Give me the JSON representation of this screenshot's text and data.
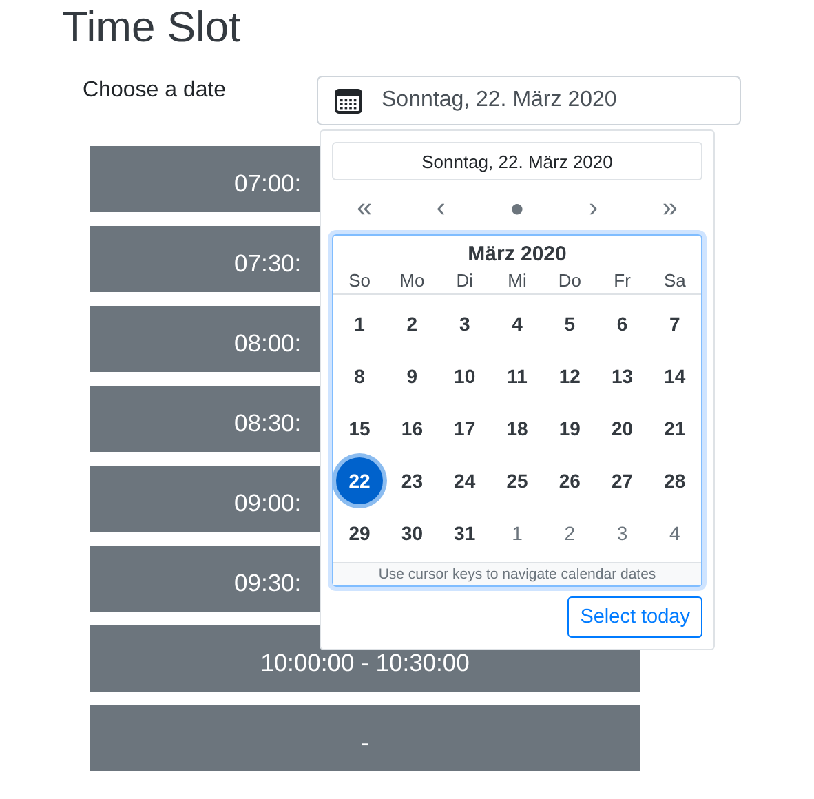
{
  "title": "Time Slot",
  "date_label": "Choose a date",
  "date_field": {
    "value": "Sonntag, 22. März 2020"
  },
  "slots": [
    {
      "label": "07:00:",
      "partly_hidden": true
    },
    {
      "label": "07:30:",
      "partly_hidden": true
    },
    {
      "label": "08:00:",
      "partly_hidden": true
    },
    {
      "label": "08:30:",
      "partly_hidden": true
    },
    {
      "label": "09:00:",
      "partly_hidden": true
    },
    {
      "label": "09:30:",
      "partly_hidden": true
    },
    {
      "label": "10:00:00 - 10:30:00",
      "partly_hidden": false
    },
    {
      "label": "-",
      "partly_hidden": false
    }
  ],
  "datepicker": {
    "selected_value": "Sonntag, 22. März 2020",
    "nav": [
      "«",
      "‹",
      "●",
      "›",
      "»"
    ],
    "month": "März 2020",
    "weekdays": [
      "So",
      "Mo",
      "Di",
      "Mi",
      "Do",
      "Fr",
      "Sa"
    ],
    "weeks": [
      [
        {
          "label": "1",
          "selected": false,
          "other_month": false
        },
        {
          "label": "2",
          "selected": false,
          "other_month": false
        },
        {
          "label": "3",
          "selected": false,
          "other_month": false
        },
        {
          "label": "4",
          "selected": false,
          "other_month": false
        },
        {
          "label": "5",
          "selected": false,
          "other_month": false
        },
        {
          "label": "6",
          "selected": false,
          "other_month": false
        },
        {
          "label": "7",
          "selected": false,
          "other_month": false
        }
      ],
      [
        {
          "label": "8",
          "selected": false,
          "other_month": false
        },
        {
          "label": "9",
          "selected": false,
          "other_month": false
        },
        {
          "label": "10",
          "selected": false,
          "other_month": false
        },
        {
          "label": "11",
          "selected": false,
          "other_month": false
        },
        {
          "label": "12",
          "selected": false,
          "other_month": false
        },
        {
          "label": "13",
          "selected": false,
          "other_month": false
        },
        {
          "label": "14",
          "selected": false,
          "other_month": false
        }
      ],
      [
        {
          "label": "15",
          "selected": false,
          "other_month": false
        },
        {
          "label": "16",
          "selected": false,
          "other_month": false
        },
        {
          "label": "17",
          "selected": false,
          "other_month": false
        },
        {
          "label": "18",
          "selected": false,
          "other_month": false
        },
        {
          "label": "19",
          "selected": false,
          "other_month": false
        },
        {
          "label": "20",
          "selected": false,
          "other_month": false
        },
        {
          "label": "21",
          "selected": false,
          "other_month": false
        }
      ],
      [
        {
          "label": "22",
          "selected": true,
          "other_month": false
        },
        {
          "label": "23",
          "selected": false,
          "other_month": false
        },
        {
          "label": "24",
          "selected": false,
          "other_month": false
        },
        {
          "label": "25",
          "selected": false,
          "other_month": false
        },
        {
          "label": "26",
          "selected": false,
          "other_month": false
        },
        {
          "label": "27",
          "selected": false,
          "other_month": false
        },
        {
          "label": "28",
          "selected": false,
          "other_month": false
        }
      ],
      [
        {
          "label": "29",
          "selected": false,
          "other_month": false
        },
        {
          "label": "30",
          "selected": false,
          "other_month": false
        },
        {
          "label": "31",
          "selected": false,
          "other_month": false
        },
        {
          "label": "1",
          "selected": false,
          "other_month": true
        },
        {
          "label": "2",
          "selected": false,
          "other_month": true
        },
        {
          "label": "3",
          "selected": false,
          "other_month": true
        },
        {
          "label": "4",
          "selected": false,
          "other_month": true
        }
      ]
    ],
    "hint": "Use cursor keys to navigate calendar dates",
    "today_button": "Select today"
  }
}
